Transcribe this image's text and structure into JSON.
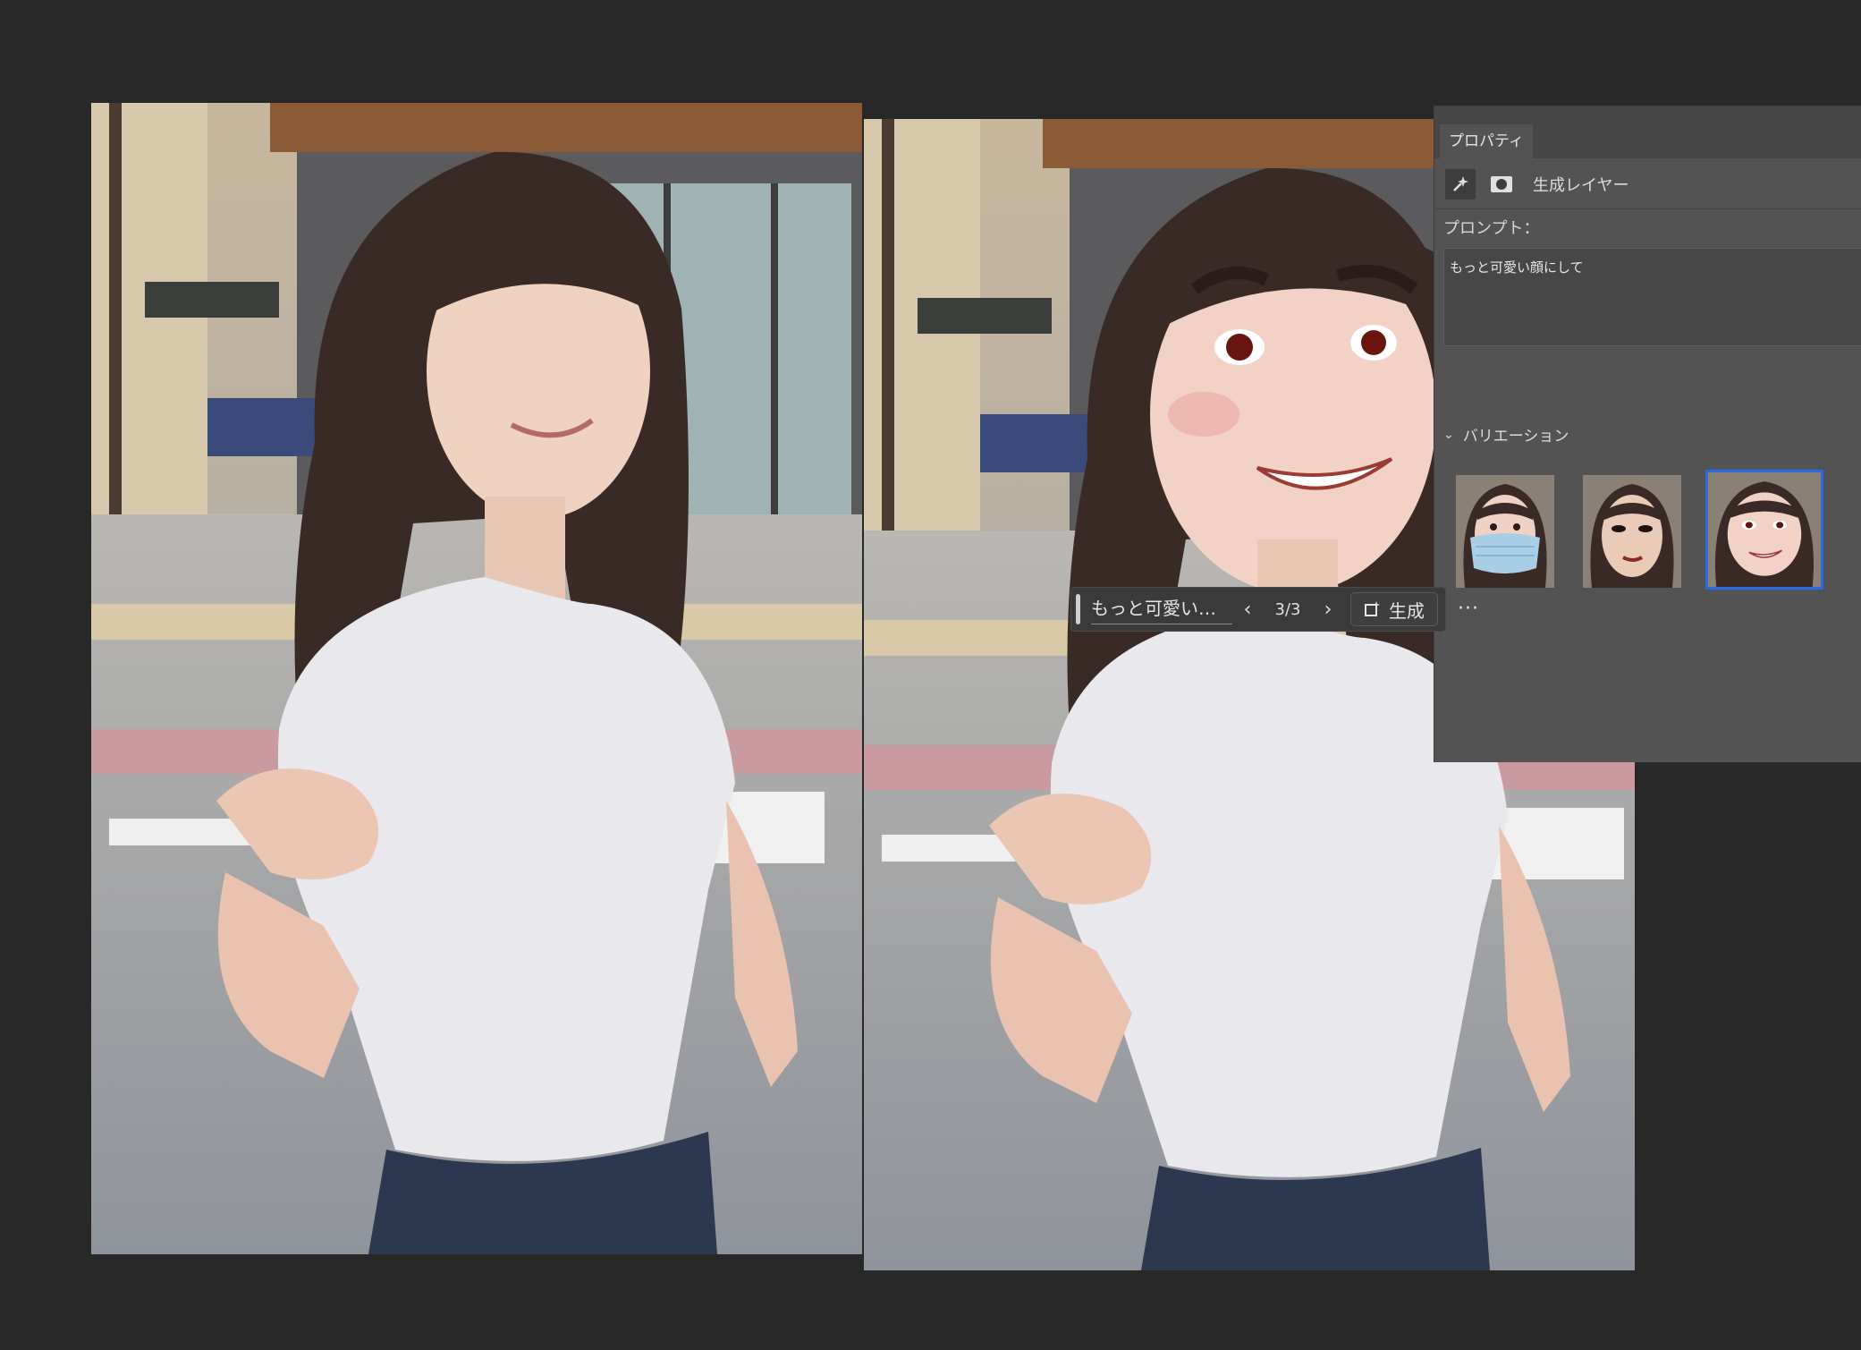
{
  "properties_panel": {
    "tab_label": "プロパティ",
    "layer_type_label": "生成レイヤー",
    "layer_icons": [
      "sparkle-icon",
      "mask-icon"
    ],
    "prompt_label": "プロンプト：",
    "prompt_text": "もっと可愛い顔にして",
    "variations_label": "バリエーション",
    "variations": [
      {
        "name": "variation-mask",
        "selected": false
      },
      {
        "name": "variation-dark-makeup",
        "selected": false
      },
      {
        "name": "variation-cartoon-smile",
        "selected": true
      }
    ]
  },
  "task_bar": {
    "prompt_preview": "もっと可愛い顔...",
    "prev_icon": "chevron-left-icon",
    "counter": "3/3",
    "next_icon": "chevron-right-icon",
    "generate_label": "生成",
    "more_label": "···"
  },
  "colors": {
    "canvas_background": "#282828",
    "panel_background": "#535353",
    "selected_border": "#2b6ae0"
  }
}
